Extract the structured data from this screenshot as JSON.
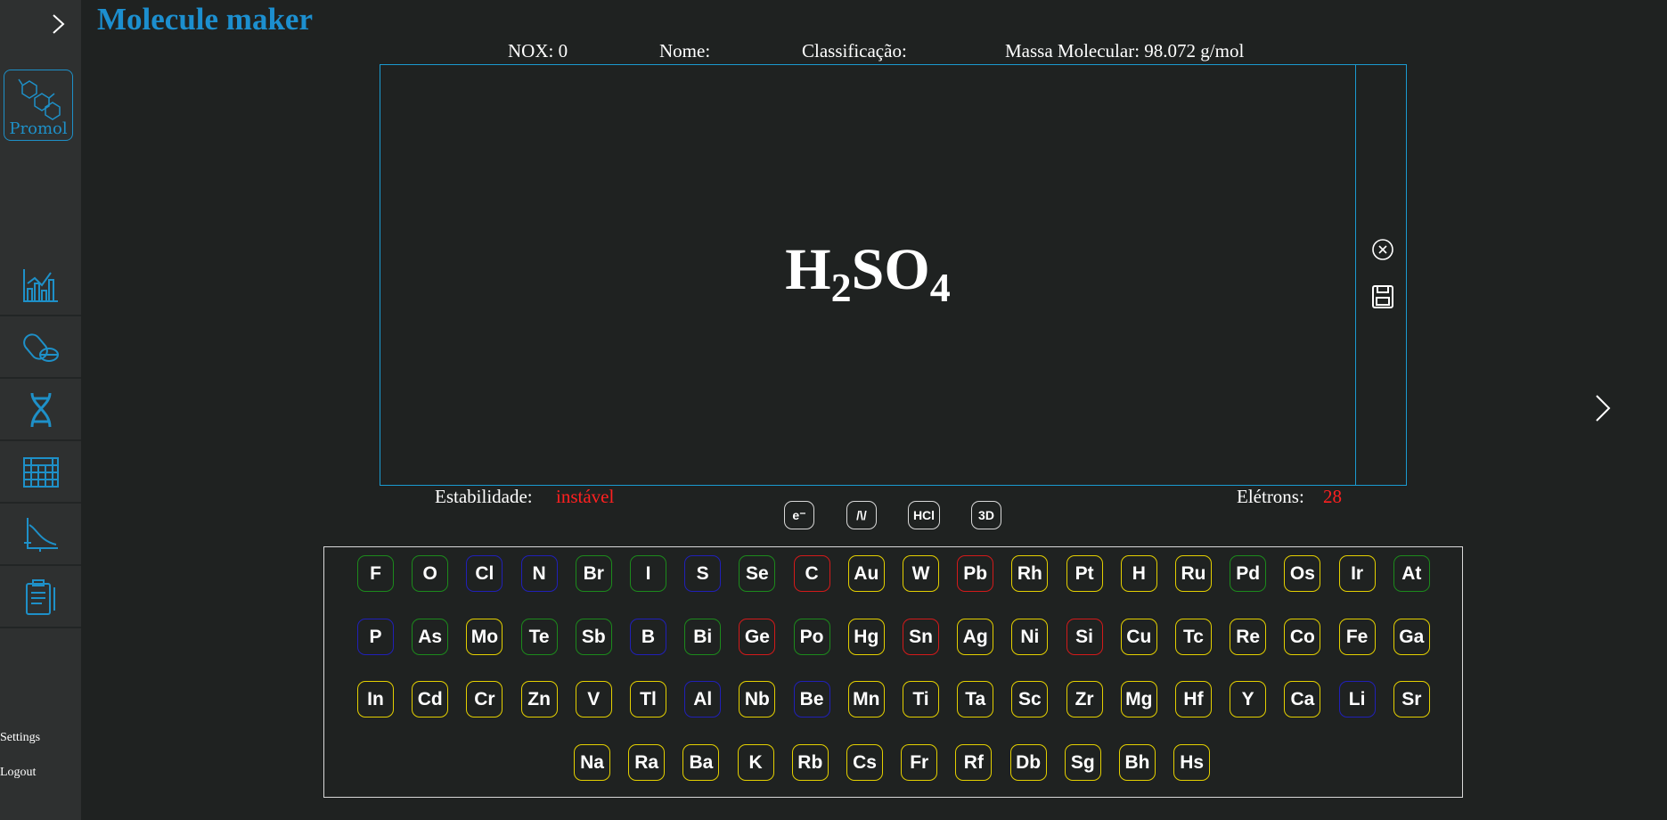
{
  "app": {
    "title": "Molecule maker"
  },
  "sidebar": {
    "expand_icon": "chevron-right-icon",
    "promol_label": "Promol",
    "nav_icons": [
      "chart-icon",
      "pills-icon",
      "dna-icon",
      "periodic-table-icon",
      "graph-icon",
      "report-icon"
    ],
    "settings_label": "Settings",
    "logout_label": "Logout"
  },
  "info": {
    "nox": "NOX: 0",
    "nome": "Nome:",
    "classificacao": "Classificação:",
    "massa": "Massa Molecular: 98.072 g/mol"
  },
  "formula": {
    "parts": [
      {
        "sym": "H"
      },
      {
        "sub": "2"
      },
      {
        "sym": "SO"
      },
      {
        "sub": "4"
      }
    ]
  },
  "tools": {
    "clear_icon": "close-circle-icon",
    "save_icon": "floppy-disk-icon"
  },
  "status": {
    "estabilidade_label": "Estabilidade:",
    "estabilidade_value": "instável",
    "eletrons_label": "Elétrons:",
    "eletrons_value": "28"
  },
  "modes": [
    {
      "label": "e⁻"
    },
    {
      "label": "/\\/"
    },
    {
      "label": "HCl"
    },
    {
      "label": "3D"
    }
  ],
  "colors": {
    "accent": "#1c8fcf",
    "unstable": "#ff2020",
    "yellow": "#e4d000",
    "green": "#1c8a1c",
    "blue": "#2020b8",
    "red": "#d31a1a"
  },
  "elements": [
    [
      [
        "F",
        "green"
      ],
      [
        "O",
        "green"
      ],
      [
        "Cl",
        "blue"
      ],
      [
        "N",
        "blue"
      ],
      [
        "Br",
        "green"
      ],
      [
        "I",
        "green"
      ],
      [
        "S",
        "blue"
      ],
      [
        "Se",
        "green"
      ],
      [
        "C",
        "red"
      ],
      [
        "Au",
        "yellow"
      ],
      [
        "W",
        "yellow"
      ],
      [
        "Pb",
        "red"
      ],
      [
        "Rh",
        "yellow"
      ],
      [
        "Pt",
        "yellow"
      ],
      [
        "H",
        "yellow"
      ],
      [
        "Ru",
        "yellow"
      ],
      [
        "Pd",
        "green"
      ],
      [
        "Os",
        "yellow"
      ],
      [
        "Ir",
        "yellow"
      ],
      [
        "At",
        "green"
      ]
    ],
    [
      [
        "P",
        "blue"
      ],
      [
        "As",
        "green"
      ],
      [
        "Mo",
        "yellow"
      ],
      [
        "Te",
        "green"
      ],
      [
        "Sb",
        "green"
      ],
      [
        "B",
        "blue"
      ],
      [
        "Bi",
        "green"
      ],
      [
        "Ge",
        "red"
      ],
      [
        "Po",
        "green"
      ],
      [
        "Hg",
        "yellow"
      ],
      [
        "Sn",
        "red"
      ],
      [
        "Ag",
        "yellow"
      ],
      [
        "Ni",
        "yellow"
      ],
      [
        "Si",
        "red"
      ],
      [
        "Cu",
        "yellow"
      ],
      [
        "Tc",
        "yellow"
      ],
      [
        "Re",
        "yellow"
      ],
      [
        "Co",
        "yellow"
      ],
      [
        "Fe",
        "yellow"
      ],
      [
        "Ga",
        "yellow"
      ]
    ],
    [
      [
        "In",
        "yellow"
      ],
      [
        "Cd",
        "yellow"
      ],
      [
        "Cr",
        "yellow"
      ],
      [
        "Zn",
        "yellow"
      ],
      [
        "V",
        "yellow"
      ],
      [
        "Tl",
        "yellow"
      ],
      [
        "Al",
        "blue"
      ],
      [
        "Nb",
        "yellow"
      ],
      [
        "Be",
        "blue"
      ],
      [
        "Mn",
        "yellow"
      ],
      [
        "Ti",
        "yellow"
      ],
      [
        "Ta",
        "yellow"
      ],
      [
        "Sc",
        "yellow"
      ],
      [
        "Zr",
        "yellow"
      ],
      [
        "Mg",
        "yellow"
      ],
      [
        "Hf",
        "yellow"
      ],
      [
        "Y",
        "yellow"
      ],
      [
        "Ca",
        "yellow"
      ],
      [
        "Li",
        "blue"
      ],
      [
        "Sr",
        "yellow"
      ]
    ],
    [
      [
        "Na",
        "yellow"
      ],
      [
        "Ra",
        "yellow"
      ],
      [
        "Ba",
        "yellow"
      ],
      [
        "K",
        "yellow"
      ],
      [
        "Rb",
        "yellow"
      ],
      [
        "Cs",
        "yellow"
      ],
      [
        "Fr",
        "yellow"
      ],
      [
        "Rf",
        "yellow"
      ],
      [
        "Db",
        "yellow"
      ],
      [
        "Sg",
        "yellow"
      ],
      [
        "Bh",
        "yellow"
      ],
      [
        "Hs",
        "yellow"
      ]
    ]
  ]
}
